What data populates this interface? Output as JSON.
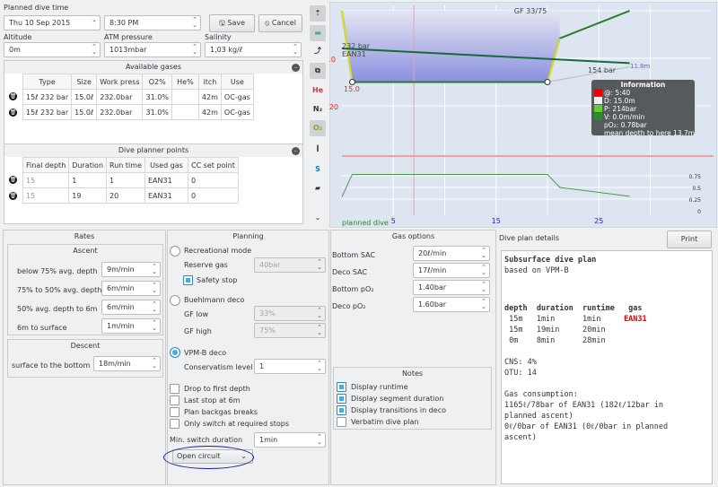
{
  "top": {
    "planned_dive_time_label": "Planned dive time",
    "date": "Thu 10 Sep 2015",
    "time": "8:30 PM",
    "save": "Save",
    "cancel": "Cancel",
    "altitude_label": "Altitude",
    "altitude": "0m",
    "atm_label": "ATM pressure",
    "atm": "1013mbar",
    "salinity_label": "Salinity",
    "salinity": "1,03 kg/ℓ"
  },
  "gases": {
    "title": "Available gases",
    "columns": [
      "Type",
      "Size",
      "Work press",
      "O2%",
      "He%",
      "itch",
      "Use"
    ],
    "rows": [
      [
        "15ℓ 232 bar",
        "15.0ℓ",
        "232.0bar",
        "31.0%",
        "",
        "42m",
        "OC-gas"
      ],
      [
        "15ℓ 232 bar",
        "15.0ℓ",
        "232.0bar",
        "31.0%",
        "",
        "42m",
        "OC-gas"
      ]
    ]
  },
  "points": {
    "title": "Dive planner points",
    "columns": [
      "Final depth",
      "Duration",
      "Run time",
      "Used gas",
      "CC set point"
    ],
    "rows": [
      [
        "15",
        "1",
        "1",
        "EAN31",
        "0"
      ],
      [
        "15",
        "19",
        "20",
        "EAN31",
        "0"
      ]
    ]
  },
  "toolbar": [
    "ceiling-icon",
    "gradient-icon",
    "deco-stop-icon",
    "tissue-icon",
    "He",
    "N₂",
    "O₂",
    "heartrate-icon",
    "sac-icon",
    "map-icon"
  ],
  "graph": {
    "gf": "GF 33/75",
    "start_pressure": "232 bar",
    "gas_label": "EAN31",
    "depth_label_10": "10",
    "depth_label_20": "20",
    "max_depth": "15.0",
    "end_pressure": "154 bar",
    "mean_depth": "11.8m",
    "time_ticks": [
      "5",
      "15",
      "25"
    ],
    "po2_ticks": [
      "0.75",
      "0.5",
      "0.25",
      "0"
    ],
    "footer": "planned dive",
    "profile": [
      [
        0,
        0
      ],
      [
        1,
        15
      ],
      [
        20,
        15
      ],
      [
        21.2,
        5.8
      ],
      [
        28,
        0
      ]
    ],
    "po2": [
      [
        0,
        0.3
      ],
      [
        1,
        0.78
      ],
      [
        20,
        0.78
      ],
      [
        21.2,
        0.5
      ],
      [
        28,
        0.31
      ]
    ],
    "pressure": [
      [
        0,
        232
      ],
      [
        28,
        154
      ]
    ],
    "info": {
      "title": "Information",
      "lines": [
        "@: 5:40",
        "D: 15.0m",
        "P: 214bar",
        "V: 0.0m/min",
        "pO₂: 0.78bar",
        "mean depth to here 13.7m"
      ]
    }
  },
  "rates": {
    "title": "Rates",
    "ascent_title": "Ascent",
    "ascent": [
      [
        "below 75% avg. depth",
        "9m/min"
      ],
      [
        "75% to 50% avg. depth",
        "6m/min"
      ],
      [
        "50% avg. depth to 6m",
        "6m/min"
      ],
      [
        "6m to surface",
        "1m/min"
      ]
    ],
    "descent_title": "Descent",
    "descent_label": "surface to the bottom",
    "descent": "18m/min"
  },
  "planning": {
    "title": "Planning",
    "recreational": "Recreational mode",
    "reserve_label": "Reserve gas",
    "reserve": "40bar",
    "safety_stop": "Safety stop",
    "buehlmann": "Buehlmann deco",
    "gf_low_label": "GF low",
    "gf_low": "33%",
    "gf_high_label": "GF high",
    "gf_high": "75%",
    "vpmb": "VPM-B deco",
    "conservatism_label": "Conservatism level",
    "conservatism": "1",
    "drop": "Drop to first depth",
    "last_stop": "Last stop at 6m",
    "backgas": "Plan backgas breaks",
    "only_switch": "Only switch at required stops",
    "min_switch_label": "Min. switch duration",
    "min_switch": "1min",
    "mode": "Open circuit"
  },
  "gas_options": {
    "title": "Gas options",
    "items": [
      [
        "Bottom SAC",
        "20ℓ/min"
      ],
      [
        "Deco SAC",
        "17ℓ/min"
      ],
      [
        "Bottom pO₂",
        "1.40bar"
      ],
      [
        "Deco pO₂",
        "1.60bar"
      ]
    ]
  },
  "notes": {
    "title": "Notes",
    "items": [
      [
        "Display runtime",
        true
      ],
      [
        "Display segment duration",
        true
      ],
      [
        "Display transitions in deco",
        true
      ],
      [
        "Verbatim dive plan",
        false
      ]
    ]
  },
  "details": {
    "title": "Dive plan details",
    "print": "Print",
    "heading": "Subsurface dive plan",
    "subheading": "based on VPM-B",
    "table_head": "depth  duration  runtime   gas",
    "rows": [
      [
        " 15m   1min      1min     ",
        "EAN31"
      ],
      [
        " 15m   19min     20min",
        ""
      ],
      [
        " 0m    8min      28min",
        ""
      ]
    ],
    "cns": "CNS: 4%",
    "otu": "OTU: 14",
    "gas_title": "Gas consumption:",
    "gas1": "1165ℓ/78bar of EAN31 (182ℓ/12bar in\nplanned ascent)",
    "gas2": "0ℓ/0bar of EAN31 (0ℓ/0bar in planned\nascent)",
    "gas_color": "#e00000"
  }
}
